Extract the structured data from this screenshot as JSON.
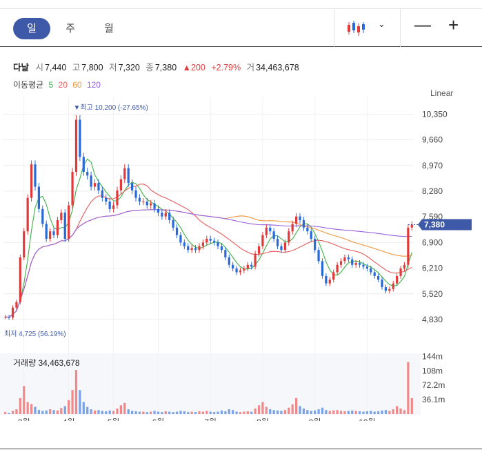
{
  "tabs": [
    {
      "label": "일"
    },
    {
      "label": "주"
    },
    {
      "label": "월"
    }
  ],
  "quote": {
    "name": "다날",
    "open_label": "시",
    "open": "7,440",
    "high_label": "고",
    "high": "7,800",
    "low_label": "저",
    "low": "7,320",
    "close_label": "종",
    "close": "7,380",
    "change": "▲200",
    "change_pct": "+2.79%",
    "volume_label": "거",
    "volume": "34,463,678"
  },
  "moving_average": {
    "label": "이동평균",
    "periods": [
      {
        "period": "5",
        "color": "#3cb043"
      },
      {
        "period": "20",
        "color": "#e85c5c"
      },
      {
        "period": "60",
        "color": "#f0963c"
      },
      {
        "period": "120",
        "color": "#9a5ee0"
      }
    ]
  },
  "scale_label": "Linear",
  "volume_title": "거래량 34,463,678",
  "colors": {
    "up": "#e03b3b",
    "down": "#2a6ad8",
    "accent": "#3d59a8"
  },
  "chart_data": {
    "type": "candlestick",
    "y_axis_ticks": [
      "10,350",
      "9,660",
      "8,970",
      "8,280",
      "7,590",
      "6,900",
      "6,210",
      "5,520",
      "4,830"
    ],
    "ylim": [
      4700,
      10450
    ],
    "x_axis_ticks": [
      "3월",
      "4월",
      "5월",
      "6월",
      "7월",
      "8월",
      "9월",
      "10월"
    ],
    "current_price_label": "7,380",
    "max_label": "최고 10,200 (-27.65%)",
    "min_label": "최저 4,725 (56.19%)",
    "volume_axis_ticks": [
      "144m",
      "108m",
      "72.2m",
      "36.1m"
    ],
    "series": [
      {
        "name": "종가",
        "values": [
          4900,
          4880,
          5150,
          5300,
          6500,
          7200,
          8100,
          9000,
          8400,
          7800,
          7400,
          7000,
          7200,
          7100,
          7500,
          7700,
          7000,
          7900,
          8800,
          10200,
          9200,
          8800,
          8700,
          8400,
          8500,
          8300,
          8100,
          8000,
          7800,
          7900,
          8300,
          8600,
          8900,
          8500,
          8300,
          8100,
          8000,
          8000,
          7900,
          7950,
          7800,
          7700,
          7600,
          7700,
          7500,
          7300,
          7100,
          6900,
          6800,
          6700,
          6750,
          6700,
          6800,
          6900,
          7000,
          6950,
          6900,
          6800,
          6700,
          6500,
          6300,
          6200,
          6100,
          6150,
          6200,
          6300,
          6250,
          6600,
          6800,
          7100,
          7300,
          7200,
          7000,
          6800,
          6700,
          6900,
          7200,
          7400,
          7600,
          7500,
          7300,
          7200,
          7000,
          6700,
          6400,
          6000,
          5800,
          5900,
          6100,
          6300,
          6400,
          6500,
          6450,
          6300,
          6350,
          6300,
          6250,
          6200,
          6100,
          6000,
          5900,
          5700,
          5600,
          5650,
          5800,
          6000,
          6200,
          6300,
          7300,
          7380
        ]
      },
      {
        "name": "거래량",
        "values": [
          5,
          3,
          8,
          12,
          40,
          70,
          30,
          25,
          18,
          10,
          8,
          9,
          12,
          10,
          9,
          15,
          20,
          35,
          60,
          110,
          60,
          30,
          18,
          12,
          9,
          10,
          8,
          7,
          9,
          8,
          14,
          22,
          28,
          12,
          8,
          7,
          6,
          6,
          5,
          6,
          8,
          6,
          5,
          7,
          6,
          5,
          6,
          8,
          7,
          5,
          6,
          5,
          7,
          6,
          8,
          6,
          5,
          6,
          9,
          7,
          12,
          10,
          6,
          5,
          6,
          7,
          6,
          14,
          22,
          30,
          18,
          12,
          10,
          9,
          8,
          10,
          16,
          24,
          40,
          20,
          14,
          10,
          8,
          9,
          12,
          16,
          10,
          8,
          9,
          10,
          8,
          7,
          8,
          9,
          8,
          7,
          6,
          7,
          8,
          6,
          7,
          9,
          10,
          8,
          12,
          20,
          14,
          10,
          130,
          40
        ]
      }
    ]
  }
}
